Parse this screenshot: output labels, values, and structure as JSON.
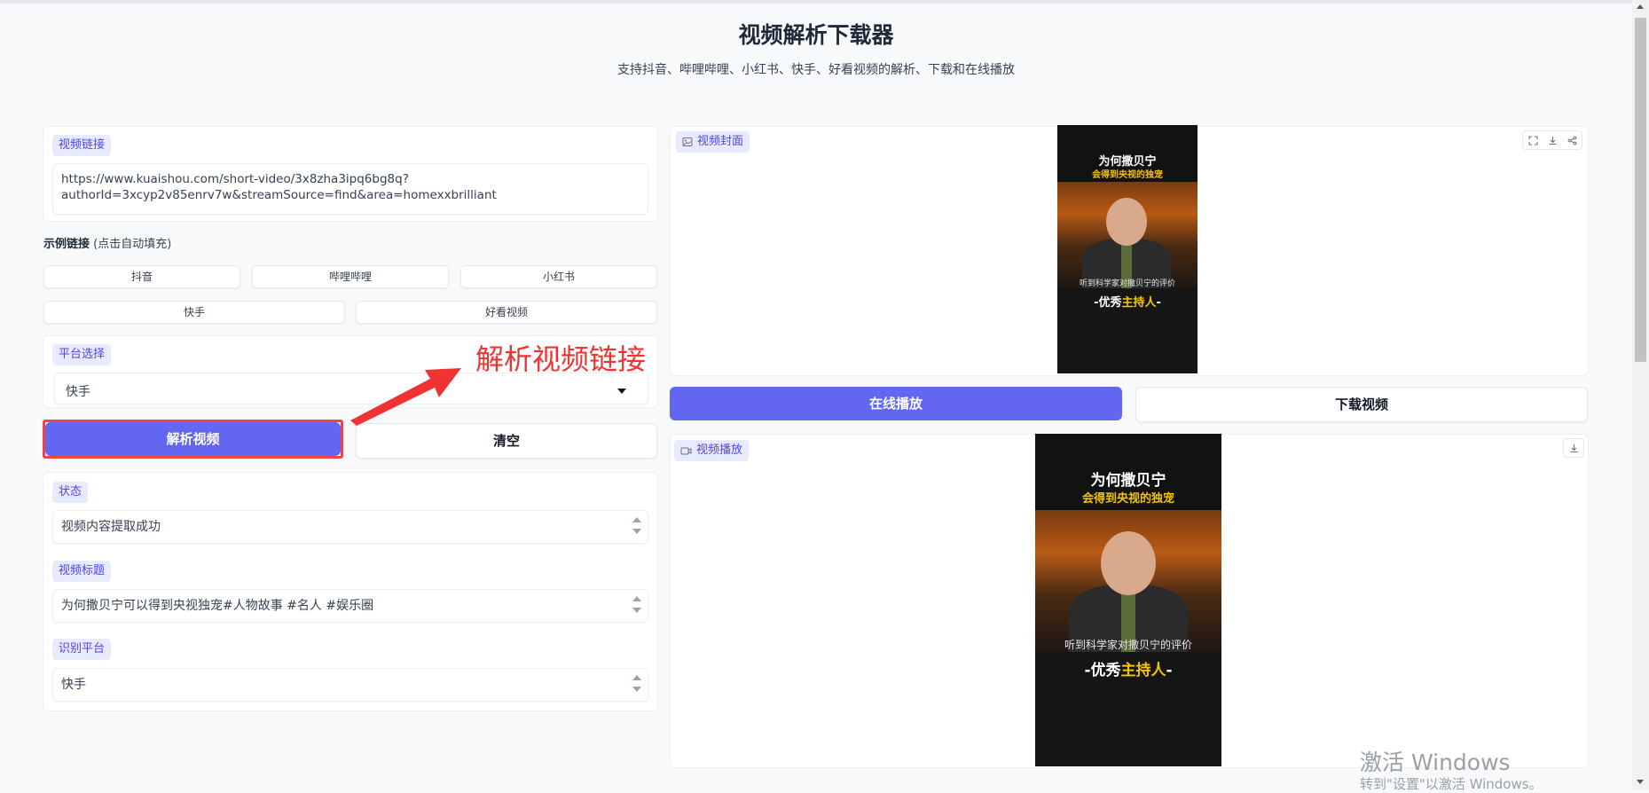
{
  "header": {
    "title": "视频解析下载器",
    "subtitle": "支持抖音、哔哩哔哩、小红书、快手、好看视频的解析、下载和在线播放"
  },
  "url_input": {
    "label": "视频链接",
    "value": "https://www.kuaishou.com/short-video/3x8zha3ipq6bg8q?\nauthorId=3xcyp2v85enrv7w&streamSource=find&area=homexxbrilliant"
  },
  "examples": {
    "label": "示例链接",
    "hint": "(点击自动填充)",
    "chips": [
      "抖音",
      "哔哩哔哩",
      "小红书",
      "快手",
      "好看视频"
    ]
  },
  "platform_select": {
    "label": "平台选择",
    "value": "快手"
  },
  "actions": {
    "parse_label": "解析视频",
    "clear_label": "清空"
  },
  "annotation": {
    "text": "解析视频链接"
  },
  "status": {
    "label": "状态",
    "value": "视频内容提取成功"
  },
  "video_title": {
    "label": "视频标题",
    "value": "为何撒贝宁可以得到央视独宠#人物故事 #名人 #娱乐圈"
  },
  "detected_platform": {
    "label": "识别平台",
    "value": "快手"
  },
  "cover": {
    "label": "视频封面",
    "title_line1": "为何撒贝宁",
    "title_line2": "会得到央视的独宠",
    "subtitle_line": "听到科学家对撒贝宁的评价",
    "host_prefix": "-优秀",
    "host_highlight": "主持人",
    "host_suffix": "-"
  },
  "media_actions": {
    "play_label": "在线播放",
    "download_label": "下载视频"
  },
  "player": {
    "label": "视频播放"
  },
  "watermark": {
    "line1": "激活 Windows",
    "line2": "转到\"设置\"以激活 Windows。"
  },
  "icons": {
    "fullscreen": "fullscreen-icon",
    "download": "download-icon",
    "share": "share-icon",
    "image": "image-icon",
    "video": "video-icon"
  },
  "colors": {
    "accent": "#6366f1",
    "tag_bg": "#e8eafe",
    "annotation": "#ef3333"
  }
}
